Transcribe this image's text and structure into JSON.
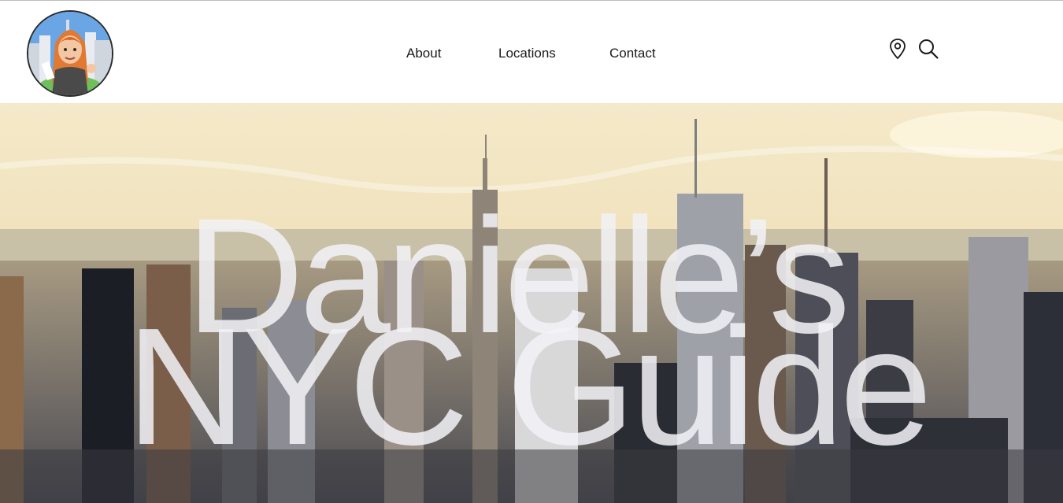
{
  "header": {
    "logo_alt": "Danielle avatar with NYC skyline",
    "nav": [
      {
        "label": "About"
      },
      {
        "label": "Locations"
      },
      {
        "label": "Contact"
      }
    ],
    "icons": [
      "location-pin-icon",
      "search-icon"
    ]
  },
  "hero": {
    "title_line1": "Danielle’s",
    "title_line2": "NYC Guide",
    "image": "aerial-nyc-skyline-sunset"
  },
  "colors": {
    "header_bg": "#ffffff",
    "nav_text": "#1a1a1a",
    "title_overlay": "#f2f2f7",
    "sky": "#f3e6c4"
  }
}
